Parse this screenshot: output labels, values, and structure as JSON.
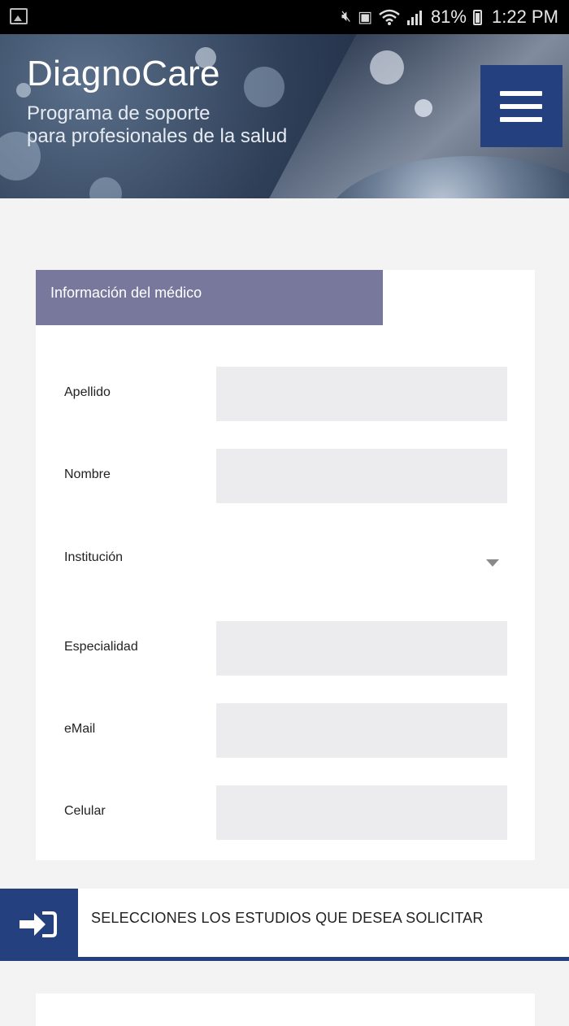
{
  "status_bar": {
    "battery_percent": "81%",
    "time": "1:22 PM"
  },
  "header": {
    "title": "DiagnoCare",
    "subtitle_line1": "Programa de soporte",
    "subtitle_line2": "para profesionales de la salud"
  },
  "form": {
    "section_title": "Información del médico",
    "fields": [
      {
        "label": "Apellido",
        "value": ""
      },
      {
        "label": "Nombre",
        "value": ""
      },
      {
        "label": "Institución",
        "value": ""
      },
      {
        "label": "Especialidad",
        "value": ""
      },
      {
        "label": "eMail",
        "value": ""
      },
      {
        "label": "Celular",
        "value": ""
      }
    ]
  },
  "step": {
    "label": "SELECCIONES LOS ESTUDIOS QUE DESEA SOLICITAR"
  },
  "colors": {
    "brand_blue": "#24407e",
    "section_header": "#77789c",
    "field_bg": "#ececee"
  }
}
